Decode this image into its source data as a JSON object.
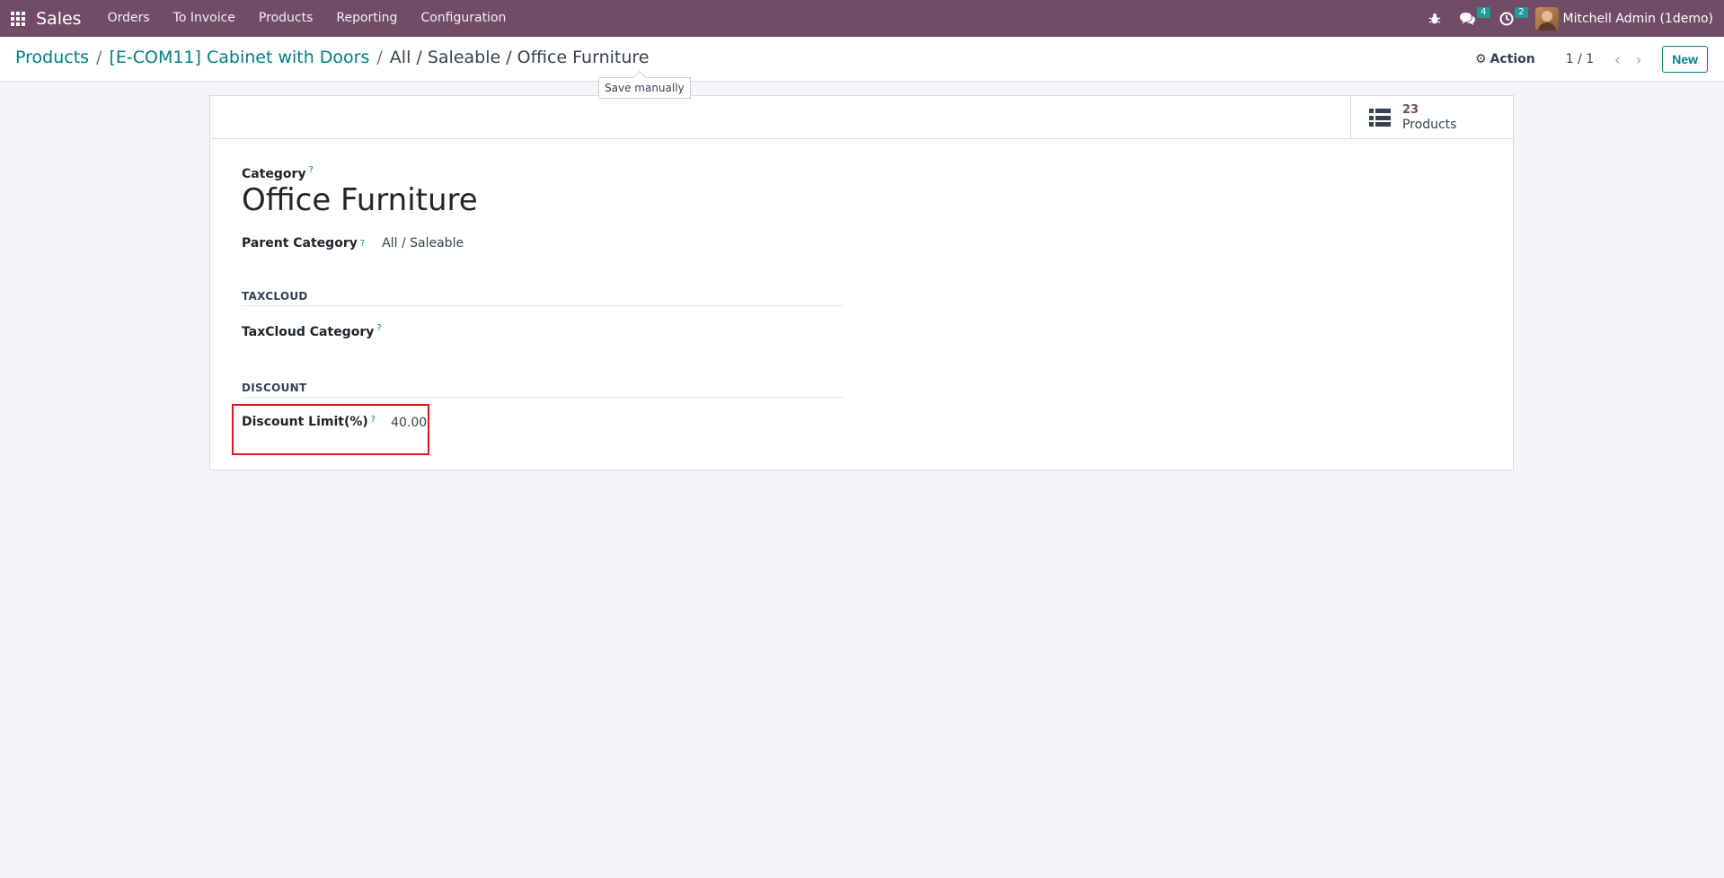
{
  "navbar": {
    "app_name": "Sales",
    "menu": [
      "Orders",
      "To Invoice",
      "Products",
      "Reporting",
      "Configuration"
    ],
    "messages_count": "4",
    "activities_count": "2",
    "user_name": "Mitchell Admin (1demo)"
  },
  "breadcrumb": {
    "items": [
      "Products",
      "[E-COM11] Cabinet with Doors"
    ],
    "current": "All / Saleable / Office Furniture",
    "separator": "/"
  },
  "tooltip": "Save manually",
  "control": {
    "action_label": "Action",
    "pager": "1 / 1",
    "new_label": "New"
  },
  "stat_button": {
    "value": "23",
    "label": "Products"
  },
  "form": {
    "category_label": "Category",
    "category_name": "Office Furniture",
    "parent_label": "Parent Category",
    "parent_value": "All / Saleable",
    "taxcloud_section": "TAXCLOUD",
    "taxcloud_label": "TaxCloud Category",
    "discount_section": "DISCOUNT",
    "discount_label": "Discount Limit(%)",
    "discount_value": "40.00",
    "help_mark": "?"
  },
  "colors": {
    "brand": "#714b67",
    "link": "#017e84",
    "badge": "#1b9e9a",
    "highlight": "#e3141f"
  }
}
